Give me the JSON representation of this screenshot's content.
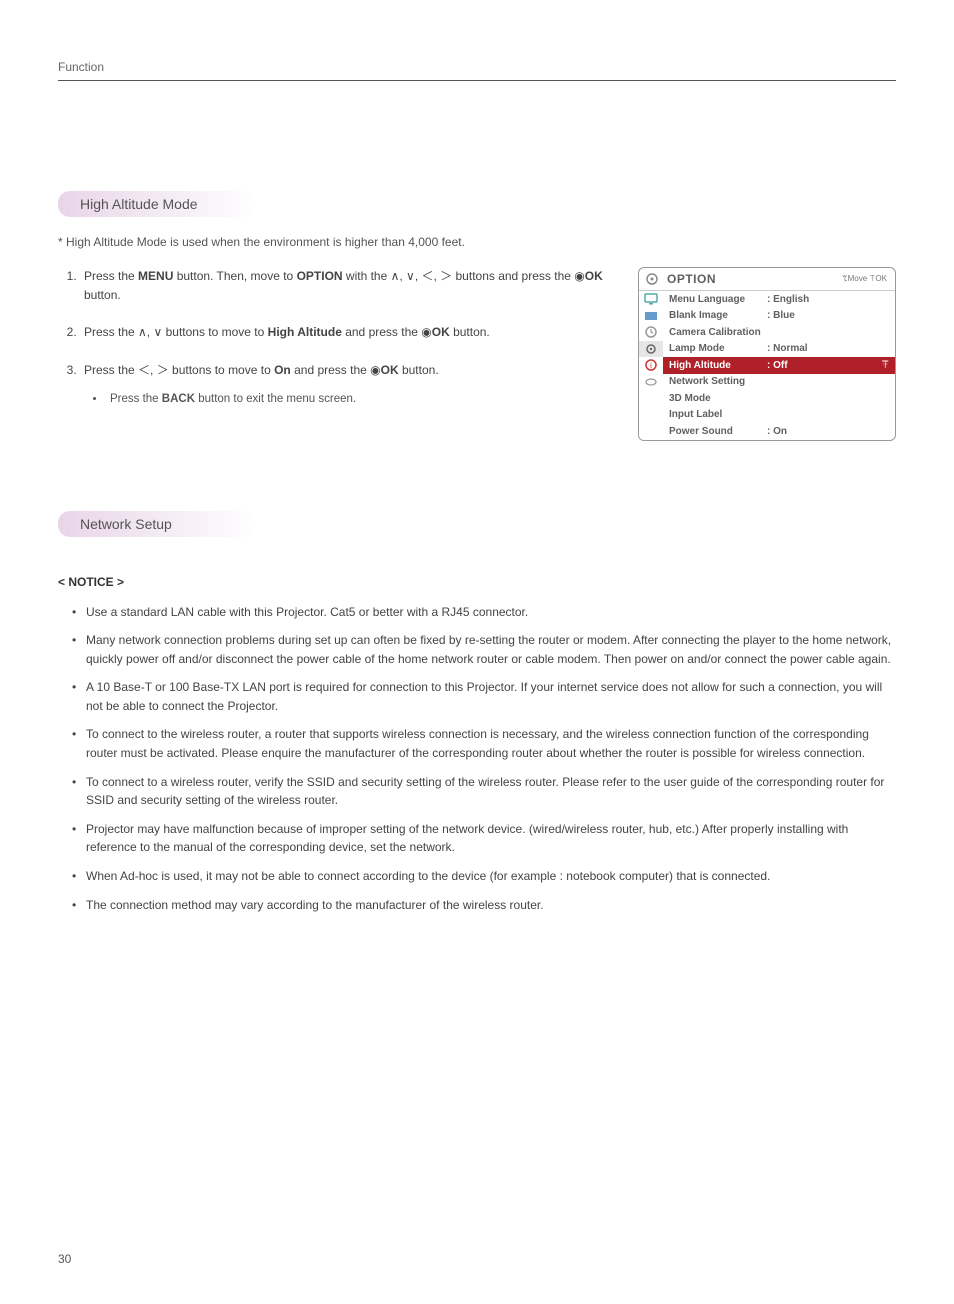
{
  "header": {
    "label": "Function"
  },
  "section1": {
    "title": "High Altitude Mode",
    "note": "* High Altitude Mode is used when the environment is higher than 4,000 feet.",
    "steps": {
      "s1_a": "Press the ",
      "s1_b": "MENU",
      "s1_c": " button. Then, move to ",
      "s1_d": "OPTION",
      "s1_e": " with the ∧, ∨, ＜, ＞ buttons and press the ◉",
      "s1_f": "OK",
      "s1_g": " button.",
      "s2_a": "Press the ∧, ∨ buttons to move to ",
      "s2_b": "High Altitude",
      "s2_c": " and press the ◉",
      "s2_d": "OK",
      "s2_e": " button.",
      "s3_a": "Press the ＜, ＞ buttons to move to ",
      "s3_b": "On",
      "s3_c": " and press the ◉",
      "s3_d": "OK",
      "s3_e": " button.",
      "sub_a": "Press the ",
      "sub_b": "BACK",
      "sub_c": " button to exit the menu screen."
    }
  },
  "osd": {
    "title": "OPTION",
    "hints": "ꔂMove    ꔉOK",
    "rows": [
      {
        "label": "Menu Language",
        "value": ": English",
        "sel": false
      },
      {
        "label": "Blank Image",
        "value": ": Blue",
        "sel": false
      },
      {
        "label": "Camera Calibration",
        "value": "",
        "sel": false
      },
      {
        "label": "Lamp Mode",
        "value": ": Normal",
        "sel": false
      },
      {
        "label": "High Altitude",
        "value": ": Off",
        "sel": true
      },
      {
        "label": "Network Setting",
        "value": "",
        "sel": false
      },
      {
        "label": "3D Mode",
        "value": "",
        "sel": false
      },
      {
        "label": "Input Label",
        "value": "",
        "sel": false
      },
      {
        "label": "Power Sound",
        "value": ": On",
        "sel": false
      }
    ]
  },
  "section2": {
    "title": "Network Setup",
    "notice_head": "< NOTICE >",
    "items": [
      "Use a standard LAN cable with this Projector. Cat5 or better with a RJ45 connector.",
      "Many network connection problems during set up can often be fixed by re-setting the router or modem. After connecting the player to the home network, quickly power off and/or disconnect the power cable of the home network router or cable modem. Then power on and/or connect the power cable again.",
      "A 10 Base-T or 100 Base-TX LAN port is required for connection to this Projector. If your internet service does not allow for such a connection, you will not be able to connect the Projector.",
      "To connect to the wireless router, a router that supports wireless connection is necessary, and the wireless connection function of the corresponding router must be activated. Please enquire the manufacturer of the corresponding router about whether the router is possible for wireless connection.",
      "To connect to a wireless router, verify the SSID and security setting of the wireless router.  Please refer to the user guide of the corresponding router for SSID and security setting of the wireless router.",
      "Projector may have malfunction because of improper setting of the network device. (wired/wireless router, hub, etc.) After properly installing with reference to the manual of the corresponding device, set the network.",
      "When Ad-hoc is used, it may not be able to connect according to the device (for example : notebook computer) that is connected.",
      "The connection method may vary according to the manufacturer of the wireless router."
    ]
  },
  "page_number": "30"
}
